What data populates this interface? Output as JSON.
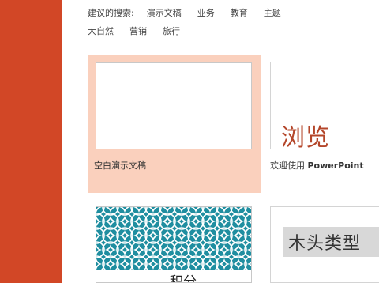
{
  "suggested_searches": {
    "label": "建议的搜索:",
    "row1": [
      "演示文稿",
      "业务",
      "教育",
      "主题"
    ],
    "row2": [
      "大自然",
      "营销",
      "旅行"
    ]
  },
  "templates": [
    {
      "caption": "空白演示文稿"
    },
    {
      "thumb_title": "浏览",
      "caption_prefix": "欢迎使用 ",
      "caption_brand": "PowerPoint"
    },
    {
      "thumb_title": "积分"
    },
    {
      "thumb_title": "木头类型"
    }
  ],
  "colors": {
    "sidebar": "#d24726",
    "selected_tile": "#fad0bd",
    "welcome_title": "#b4462a",
    "pattern_teal": "#1f8ea0"
  }
}
